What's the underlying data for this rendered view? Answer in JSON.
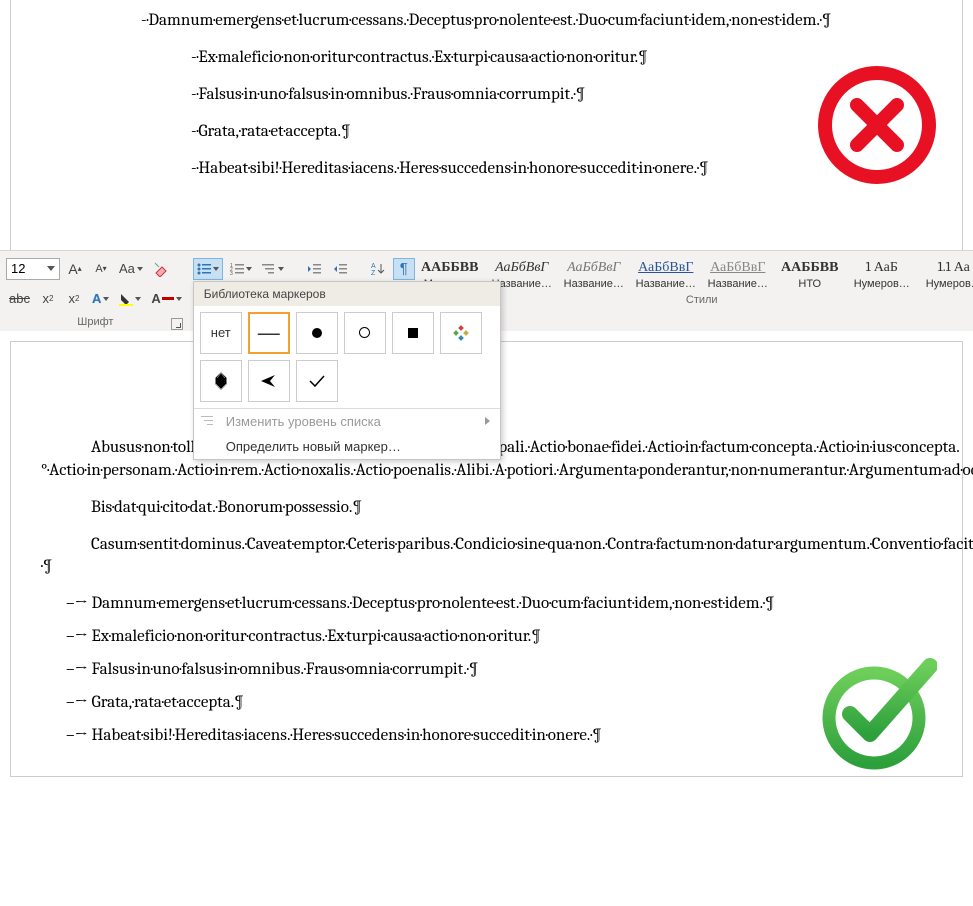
{
  "upper_doc": {
    "lines": [
      "-·Damnum·emergens·et·lucrum·cessans.·Deceptus·pro·nolente·est.·Duo·cum·faciunt·idem,·non·est·idem.·¶",
      "-·Ex·maleficio·non·oritur·contractus.·Ex·turpi·causa·actio·non·oritur.¶",
      "-·Falsus·in·uno·falsus·in·omnibus.·Fraus·omnia·corrumpit.·¶",
      "-·Grata,·rata·et·accepta.¶",
      "-·Habeat·sibi!·Hereditas·iacens.·Heres·succedens·in·honore·succedit·in·onere.·¶"
    ]
  },
  "ribbon": {
    "font_size": "12",
    "font_group_label": "Шрифт",
    "styles_group_label": "Стили",
    "styles": [
      {
        "sample": "ААББВВ",
        "name": "Место р…",
        "sample_style": "font-weight:bold;"
      },
      {
        "sample": "АаБбВвГ",
        "name": "Название…",
        "sample_style": "font-style:italic;"
      },
      {
        "sample": "АаБбВвГ",
        "name": "Название…",
        "sample_style": "font-style:italic;color:#777;"
      },
      {
        "sample": "АаБбВвГ",
        "name": "Название…",
        "sample_style": "text-decoration:underline;color:#2a579a;"
      },
      {
        "sample": "АаБбВвГ",
        "name": "Название…",
        "sample_style": "text-decoration:underline;color:#888;"
      },
      {
        "sample": "ААББВВ",
        "name": "НТО",
        "sample_style": "font-weight:bold;"
      },
      {
        "sample": "1 АаБ",
        "name": "Нумеров…",
        "sample_style": ""
      },
      {
        "sample": "1.1 Аа",
        "name": "Нумеров…",
        "sample_style": ""
      }
    ]
  },
  "bullet_panel": {
    "header": "Библиотека маркеров",
    "none_label": "нет",
    "change_level": "Изменить уровень списка",
    "define_new": "Определить новый маркер…"
  },
  "lower_doc": {
    "paras": [
      "Abusus·non·tollit·usum.·Accepto·damno.·Accessio·cedit·principali.·Actio·bonae·fidei.·Actio·in·factum·concepta.·Actio·in·ius·concepta.°·Actio·in·personam.·Actio·in·rem.·Actio·noxalis.·Actio·poenalis.·Alibi.·A·potiori.·Argumenta·ponderantur,·non·numerantur.·Argumentum·ad·oculos.¶",
      "Bis·dat·qui·cito·dat.·Bonorum·possessio.¶",
      "Casum·sentit·dominus.·Caveat·emptor.·Ceteris·paribus.·Condicio·sine·qua·non.·Contra·factum·non·datur·argumentum.·Conventio·facit·legam.·Corpus·delicti.·Crescente·malitia·crescere·debet·et·poena.·Cuius·commodum,·eius·debet·esse·incommodum.·Cuius·commodum,·eius·periculum.·Curia·advisare·vult!·¶"
    ],
    "list": [
      "Damnum·emergens·et·lucrum·cessans.·Deceptus·pro·nolente·est.·Duo·cum·faciunt·idem,·non·est·idem.·¶",
      "Ex·maleficio·non·oritur·contractus.·Ex·turpi·causa·actio·non·oritur.¶",
      "Falsus·in·uno·falsus·in·omnibus.·Fraus·omnia·corrumpit.·¶",
      "Grata,·rata·et·accepta.¶",
      "Habeat·sibi!·Hereditas·iacens.·Heres·succedens·in·honore·succedit·in·onere.·¶"
    ]
  },
  "icons": {
    "wrong": "wrong-icon",
    "right": "right-icon"
  }
}
